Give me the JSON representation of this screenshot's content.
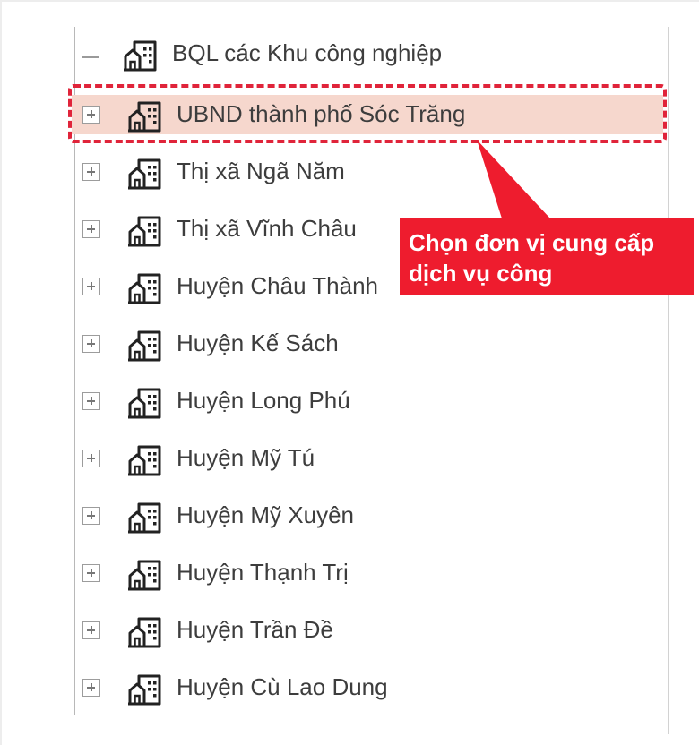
{
  "tree": {
    "root": {
      "label": "BQL các Khu công nghiệp",
      "state": "expanded"
    },
    "items": [
      {
        "label": "UBND thành phố Sóc Trăng",
        "state": "collapsed",
        "highlighted": true
      },
      {
        "label": "Thị xã Ngã Năm",
        "state": "collapsed"
      },
      {
        "label": "Thị xã Vĩnh Châu",
        "state": "collapsed"
      },
      {
        "label": "Huyện Châu Thành",
        "state": "collapsed"
      },
      {
        "label": "Huyện Kế Sách",
        "state": "collapsed"
      },
      {
        "label": "Huyện Long Phú",
        "state": "collapsed"
      },
      {
        "label": "Huyện Mỹ Tú",
        "state": "collapsed"
      },
      {
        "label": "Huyện Mỹ Xuyên",
        "state": "collapsed"
      },
      {
        "label": "Huyện Thạnh Trị",
        "state": "collapsed"
      },
      {
        "label": "Huyện Trần Đề",
        "state": "collapsed"
      },
      {
        "label": "Huyện Cù Lao Dung",
        "state": "collapsed"
      }
    ],
    "icons": {
      "node": "building-icon",
      "expand": "plus-box-icon",
      "collapse": "minus-dash-icon"
    }
  },
  "callout": {
    "line1": "Chọn đơn vị cung cấp",
    "line2": "dịch vụ công",
    "color": "#ee1c2e"
  },
  "colors": {
    "highlight_fill": "#f6d7cd",
    "highlight_border": "#e0243a",
    "text": "#3d3d3d"
  }
}
